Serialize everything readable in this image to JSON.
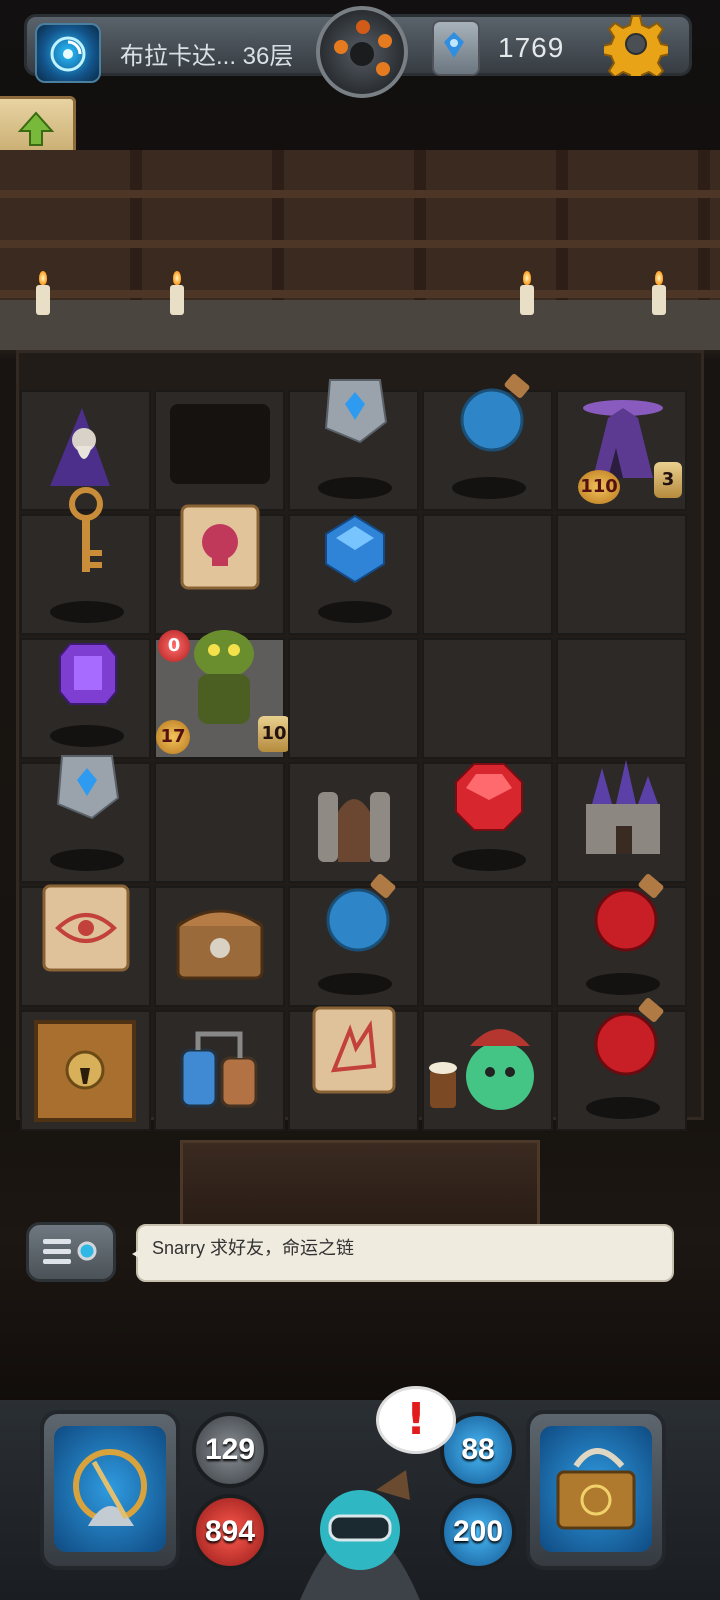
{
  "hud": {
    "floor_name": "布拉卡达... 36层",
    "score": "1769"
  },
  "board": {
    "cells": [
      [
        "wizard-npc",
        "broken-floor",
        "rune-stone",
        "blue-potion",
        "dark-crystal-altar"
      ],
      [
        "golden-key",
        "skull-scroll",
        "blue-gem",
        "empty",
        "empty"
      ],
      [
        "purple-gem",
        "goblin-monster",
        "empty",
        "empty",
        "empty"
      ],
      [
        "rune-stone",
        "empty",
        "stone-shrine",
        "red-gem",
        "dark-castle"
      ],
      [
        "eye-scroll",
        "treasure-chest",
        "blue-potion",
        "empty",
        "red-potion"
      ],
      [
        "locked-door",
        "alchemy-machine",
        "fire-scroll",
        "merchant-npc",
        "red-potion"
      ]
    ],
    "altar": {
      "attack": "110",
      "scrolls": "3"
    },
    "goblin": {
      "hp_top": "0",
      "attack": "17",
      "scrolls": "10"
    }
  },
  "chat": {
    "message": "Snarry 求好友，命运之链"
  },
  "stats": {
    "attack": "129",
    "health": "894",
    "defense": "88",
    "mana": "200"
  },
  "alert_mark": "!",
  "colors": {
    "accent_gold": "#f2c35b",
    "health_red": "#b01e1e",
    "mana_blue": "#135792"
  }
}
